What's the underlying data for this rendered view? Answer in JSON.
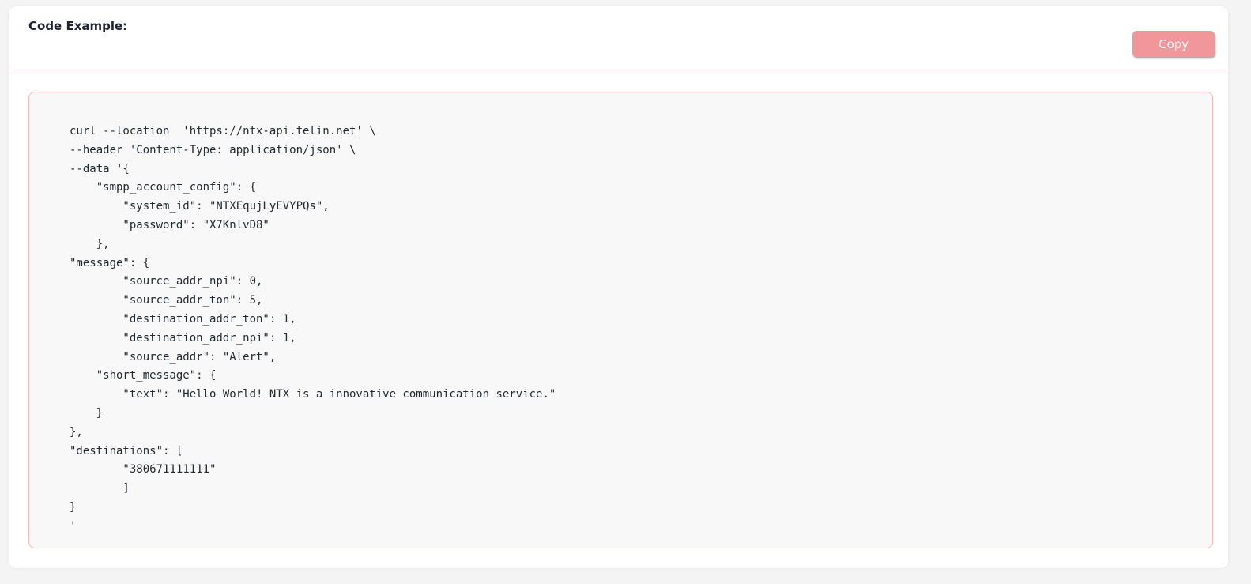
{
  "card": {
    "title": "Code Example:",
    "copy_label": "Copy"
  },
  "code": {
    "lines": [
      "curl --location  'https://ntx-api.telin.net' \\",
      "--header 'Content-Type: application/json' \\",
      "--data '{",
      "    \"smpp_account_config\": {",
      "        \"system_id\": \"NTXEqujLyEVYPQs\",",
      "        \"password\": \"X7KnlvD8\"",
      "    },",
      "\"message\": {",
      "        \"source_addr_npi\": 0,",
      "        \"source_addr_ton\": 5,",
      "        \"destination_addr_ton\": 1,",
      "        \"destination_addr_npi\": 1,",
      "        \"source_addr\": \"Alert\",",
      "    \"short_message\": {",
      "        \"text\": \"Hello World! NTX is a innovative communication service.\"",
      "    }",
      "},",
      "\"destinations\": [",
      "        \"380671111111\"",
      "        ]",
      "}",
      "'"
    ]
  },
  "colors": {
    "accent": "#f1979c",
    "code_border": "#f3b8c0",
    "code_bg": "#f8f8f8"
  }
}
